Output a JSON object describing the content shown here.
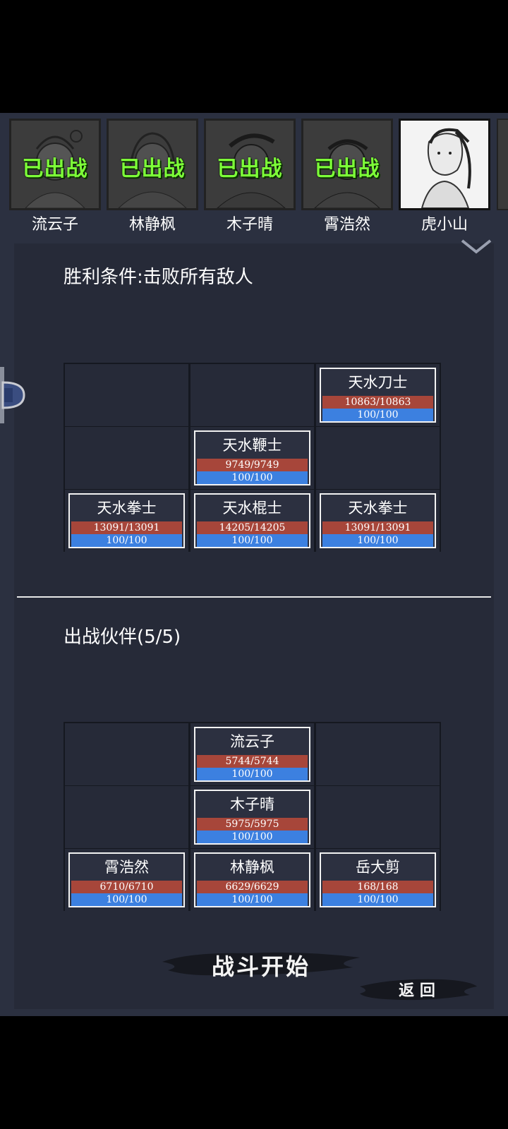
{
  "portraits": [
    {
      "name": "流云子",
      "status": "已出战",
      "active": false
    },
    {
      "name": "林静枫",
      "status": "已出战",
      "active": false
    },
    {
      "name": "木子晴",
      "status": "已出战",
      "active": false
    },
    {
      "name": "霄浩然",
      "status": "已出战",
      "active": false
    },
    {
      "name": "虎小山",
      "status": "",
      "active": true
    }
  ],
  "victory_condition": "胜利条件:击败所有敌人",
  "enemies": {
    "r0c2": {
      "name": "天水刀士",
      "hp": "10863/10863",
      "mp": "100/100"
    },
    "r1c1": {
      "name": "天水鞭士",
      "hp": "9749/9749",
      "mp": "100/100"
    },
    "r2c0": {
      "name": "天水拳士",
      "hp": "13091/13091",
      "mp": "100/100"
    },
    "r2c1": {
      "name": "天水棍士",
      "hp": "14205/14205",
      "mp": "100/100"
    },
    "r2c2": {
      "name": "天水拳士",
      "hp": "13091/13091",
      "mp": "100/100"
    }
  },
  "partners_heading": "出战伙伴(5/5)",
  "partners": {
    "r0c1": {
      "name": "流云子",
      "hp": "5744/5744",
      "mp": "100/100"
    },
    "r1c1": {
      "name": "木子晴",
      "hp": "5975/5975",
      "mp": "100/100"
    },
    "r2c0": {
      "name": "霄浩然",
      "hp": "6710/6710",
      "mp": "100/100"
    },
    "r2c1": {
      "name": "林静枫",
      "hp": "6629/6629",
      "mp": "100/100"
    },
    "r2c2": {
      "name": "岳大剪",
      "hp": "168/168",
      "mp": "100/100"
    }
  },
  "start_battle_label": "战斗开始",
  "back_label": "返 回",
  "colors": {
    "deployed_text": "#7dff38",
    "hp_bar": "#a7463a",
    "mp_bar": "#3c80e0",
    "panel": "#262a38"
  }
}
